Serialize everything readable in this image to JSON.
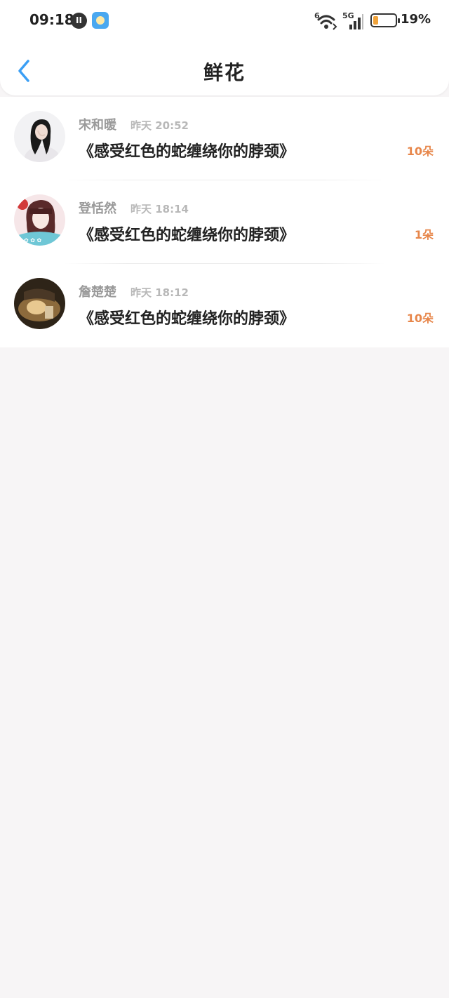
{
  "status_bar": {
    "time": "09:18",
    "net_badge": "6",
    "signal_label": "5G",
    "battery_percent": "19%",
    "battery_level": 0.19,
    "icons": [
      "notification-dark-icon",
      "app-icon",
      "wifi-icon",
      "cell-signal-icon",
      "battery-icon"
    ]
  },
  "header": {
    "title": "鲜花",
    "back_icon": "chevron-left-icon"
  },
  "colors": {
    "accent_blue": "#3b9ff5",
    "count_orange": "#e7864a",
    "battery_orange": "#f0a33b"
  },
  "list": [
    {
      "name": "宋和暖",
      "time": "昨天 20:52",
      "work_title": "《感受红色的蛇缠绕你的脖颈》",
      "count": "10朵"
    },
    {
      "name": "登恬然",
      "time": "昨天 18:14",
      "work_title": "《感受红色的蛇缠绕你的脖颈》",
      "count": "1朵"
    },
    {
      "name": "詹楚楚",
      "time": "昨天 18:12",
      "work_title": "《感受红色的蛇缠绕你的脖颈》",
      "count": "10朵"
    }
  ]
}
